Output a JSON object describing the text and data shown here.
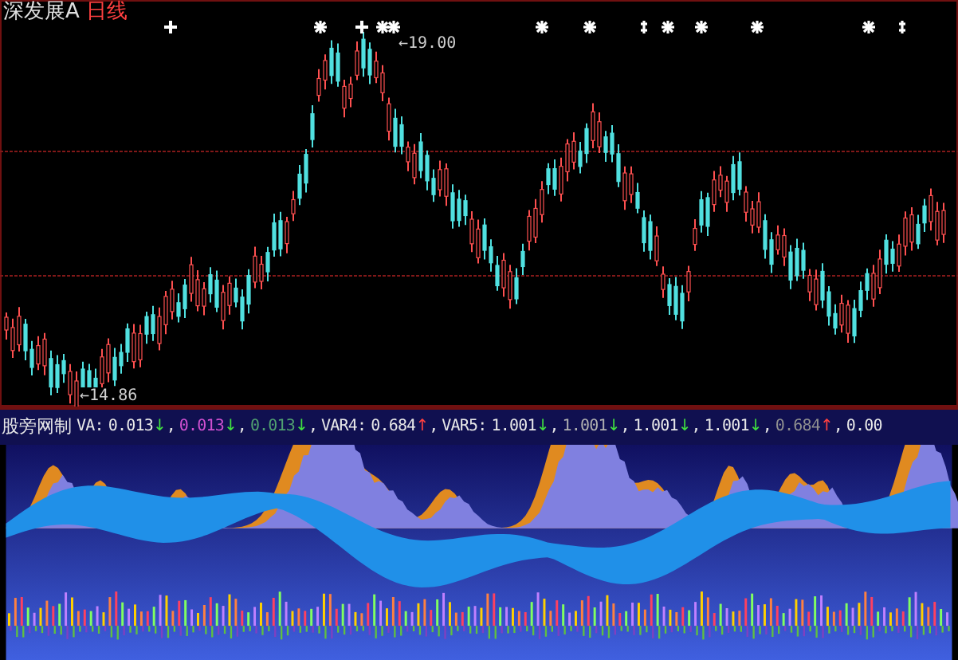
{
  "header": {
    "stock": "深发展A",
    "period": "日线"
  },
  "price_chart": {
    "high_label": "←19.00",
    "low_label": "←14.86",
    "markers": [
      {
        "kind": "plus"
      },
      {
        "kind": "star"
      },
      {
        "kind": "plus"
      },
      {
        "kind": "star"
      },
      {
        "kind": "star"
      },
      {
        "kind": "star"
      },
      {
        "kind": "star"
      },
      {
        "kind": "dagger"
      },
      {
        "kind": "star"
      },
      {
        "kind": "star"
      },
      {
        "kind": "star"
      },
      {
        "kind": "star"
      },
      {
        "kind": "dagger"
      }
    ]
  },
  "indicator": {
    "title": "股旁网制",
    "values": [
      {
        "label": "VA:",
        "value": "0.013",
        "color": "#e8e8e8",
        "arrow": {
          "text": "↓",
          "color": "#40e040"
        },
        "separator": ","
      },
      {
        "value": "0.013",
        "color": "#d050d0",
        "arrow": {
          "text": "↓",
          "color": "#40e040"
        },
        "separator": ","
      },
      {
        "value": "0.013",
        "color": "#50a070",
        "arrow": {
          "text": "↓",
          "color": "#40e040"
        },
        "separator": ","
      },
      {
        "label": "VAR4:",
        "value": "0.684",
        "color": "#e8e8e8",
        "arrow": {
          "text": "↑",
          "color": "#ff4040"
        },
        "separator": ","
      },
      {
        "label": "VAR5:",
        "value": "1.001",
        "color": "#e8e8e8",
        "arrow": {
          "text": "↓",
          "color": "#40e040"
        },
        "separator": ","
      },
      {
        "value": "1.001",
        "color": "#b0b0b0",
        "arrow": {
          "text": "↓",
          "color": "#40e040"
        },
        "separator": ","
      },
      {
        "value": "1.001",
        "color": "#e8e8e8",
        "arrow": {
          "text": "↓",
          "color": "#40e040"
        },
        "separator": ","
      },
      {
        "value": "1.001",
        "color": "#e8e8e8",
        "arrow": {
          "text": "↓",
          "color": "#40e040"
        },
        "separator": ","
      },
      {
        "value": "0.684",
        "color": "#909090",
        "arrow": {
          "text": "↑",
          "color": "#ff4040"
        },
        "separator": ","
      },
      {
        "value": "0.00",
        "color": "#e8e8e8"
      }
    ]
  }
}
